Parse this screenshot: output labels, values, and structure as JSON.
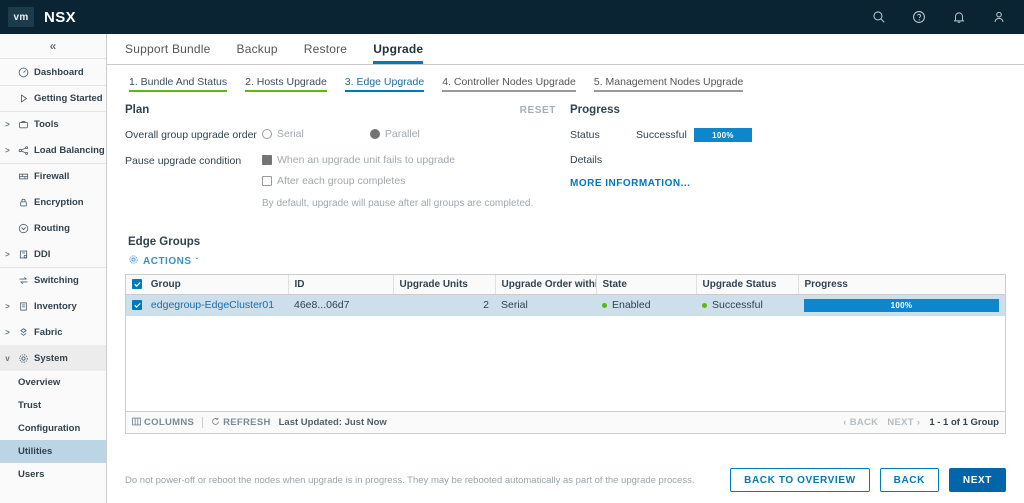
{
  "header": {
    "logo_text": "vm",
    "product": "NSX",
    "icons": [
      {
        "name": "search-icon",
        "label": "Search"
      },
      {
        "name": "help-icon",
        "label": "Help"
      },
      {
        "name": "bell-icon",
        "label": "Alarms"
      },
      {
        "name": "user-icon",
        "label": "Account"
      }
    ]
  },
  "sidebar": {
    "collapse_glyph": "«",
    "items": [
      {
        "label": "Dashboard",
        "icon": "dashboard-icon",
        "caret": "",
        "state": ""
      },
      {
        "label": "Getting Started",
        "icon": "play-icon",
        "caret": "",
        "state": ""
      },
      {
        "label": "Tools",
        "icon": "tools-icon",
        "caret": ">",
        "state": ""
      },
      {
        "label": "Load Balancing",
        "icon": "load-balancing-icon",
        "caret": ">",
        "state": ""
      },
      {
        "label": "Firewall",
        "icon": "firewall-icon",
        "caret": "",
        "state": ""
      },
      {
        "label": "Encryption",
        "icon": "lock-icon",
        "caret": "",
        "state": ""
      },
      {
        "label": "Routing",
        "icon": "routing-icon",
        "caret": "",
        "state": ""
      },
      {
        "label": "DDI",
        "icon": "ddi-icon",
        "caret": ">",
        "state": ""
      },
      {
        "label": "Switching",
        "icon": "switching-icon",
        "caret": "",
        "state": ""
      },
      {
        "label": "Inventory",
        "icon": "inventory-icon",
        "caret": ">",
        "state": ""
      },
      {
        "label": "Fabric",
        "icon": "fabric-icon",
        "caret": ">",
        "state": ""
      },
      {
        "label": "System",
        "icon": "gear-icon",
        "caret": "v",
        "state": "expanded"
      }
    ],
    "system_children": [
      {
        "label": "Overview",
        "active": false
      },
      {
        "label": "Trust",
        "active": false
      },
      {
        "label": "Configuration",
        "active": false
      },
      {
        "label": "Utilities",
        "active": true
      },
      {
        "label": "Users",
        "active": false
      }
    ]
  },
  "tabs": [
    {
      "label": "Support Bundle",
      "active": false
    },
    {
      "label": "Backup",
      "active": false
    },
    {
      "label": "Restore",
      "active": false
    },
    {
      "label": "Upgrade",
      "active": true
    }
  ],
  "steps": [
    {
      "label": "1. Bundle And Status",
      "state": "done"
    },
    {
      "label": "2. Hosts Upgrade",
      "state": "done"
    },
    {
      "label": "3. Edge Upgrade",
      "state": "active"
    },
    {
      "label": "4. Controller Nodes Upgrade",
      "state": ""
    },
    {
      "label": "5. Management Nodes Upgrade",
      "state": ""
    }
  ],
  "plan": {
    "title": "Plan",
    "reset_label": "RESET",
    "order_label": "Overall group upgrade order",
    "order_options": [
      {
        "label": "Serial",
        "selected": false
      },
      {
        "label": "Parallel",
        "selected": true
      }
    ],
    "pause_label": "Pause upgrade condition",
    "pause_options": [
      {
        "label": "When an upgrade unit fails to upgrade",
        "checked": true
      },
      {
        "label": "After each group completes",
        "checked": false
      }
    ],
    "hint": "By default, upgrade will pause after all groups are completed."
  },
  "progress": {
    "title": "Progress",
    "status_label": "Status",
    "status_value": "Successful",
    "status_percent": "100%",
    "details_label": "Details",
    "details_value": "",
    "more_link": "MORE INFORMATION..."
  },
  "edge_groups": {
    "title": "Edge Groups",
    "actions_label": "ACTIONS",
    "actions_caret": "ˇ",
    "columns": [
      "Group",
      "ID",
      "Upgrade Units",
      "Upgrade Order within Gr",
      "State",
      "Upgrade Status",
      "Progress"
    ],
    "rows": [
      {
        "selected": true,
        "group": "edgegroup-EdgeCluster01",
        "id": "46e8...06d7",
        "upgrade_units": "2",
        "upgrade_order": "Serial",
        "state": "Enabled",
        "upgrade_status": "Successful",
        "progress": "100%"
      }
    ],
    "footer": {
      "columns_label": "COLUMNS",
      "refresh_label": "REFRESH",
      "last_updated": "Last Updated: Just Now",
      "back_label": "BACK",
      "next_label": "NEXT",
      "count": "1 - 1 of 1 Group"
    }
  },
  "footer": {
    "warning": "Do not power-off or reboot the nodes when upgrade is in progress. They may be rebooted automatically as part of the upgrade process.",
    "buttons": [
      {
        "label": "BACK TO OVERVIEW",
        "primary": false
      },
      {
        "label": "BACK",
        "primary": false
      },
      {
        "label": "NEXT",
        "primary": true
      }
    ]
  },
  "colors": {
    "header_bg": "#0a2433",
    "accent_blue": "#0079b8",
    "progress_blue": "#0e86cc",
    "done_green": "#5eb715",
    "status_green": "#60b515",
    "row_selected": "#ccdfeb"
  }
}
